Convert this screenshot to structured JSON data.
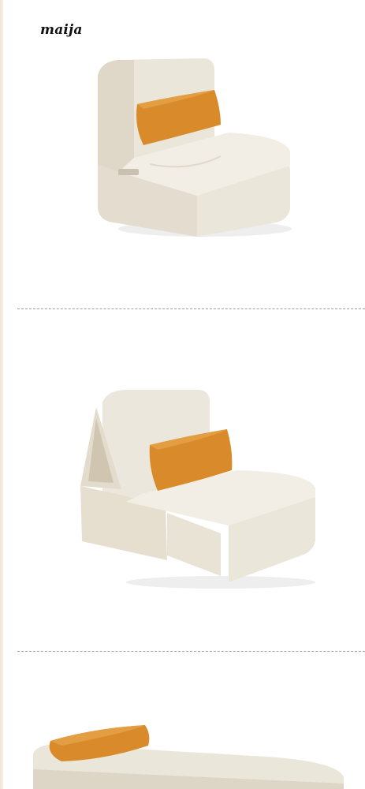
{
  "brand": {
    "name": "maija"
  },
  "colors": {
    "fabric": "#ece7dc",
    "fabric_shadow": "#d8d1c2",
    "pillow": "#d98b2b",
    "divider": "#9c9c9c"
  },
  "product_images": [
    {
      "id": "folded-chair",
      "icon": "sofa-chair-image"
    },
    {
      "id": "half-unfolded",
      "icon": "sofa-half-open-image"
    },
    {
      "id": "bed-mode",
      "icon": "sofa-bed-image"
    }
  ]
}
